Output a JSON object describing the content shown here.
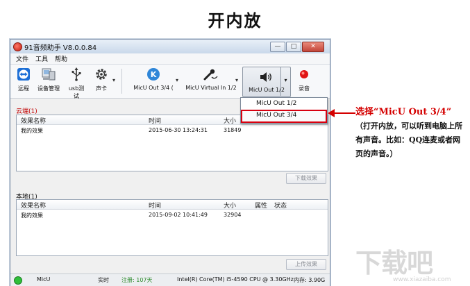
{
  "heading": "开内放",
  "window": {
    "title": "91音频助手 V8.0.0.84",
    "controls": {
      "minimize": "—",
      "maximize": "□",
      "close": "✕"
    },
    "menu": [
      "文件",
      "工具",
      "帮助"
    ]
  },
  "toolbar": {
    "remote": "远程",
    "devices": "设备管理",
    "usb": "usb测试",
    "soundcard": "声卡",
    "micu_out34": "MicU Out 3/4 (",
    "micu_virtual": "MicU Virtual In 1/2",
    "micu_out12": "MicU Out 1/2",
    "record": "录音"
  },
  "dropdown": {
    "options": [
      "MicU Out 1/2",
      "MicU Out 3/4"
    ],
    "selected_index": 1
  },
  "cloud": {
    "label": "云端(1)",
    "columns": [
      "效果名称",
      "时间",
      "大小"
    ],
    "rows": [
      {
        "name": "我的效果",
        "time": "2015-06-30 13:24:31",
        "size": "31849"
      }
    ],
    "button": "下载效果"
  },
  "local": {
    "label": "本地(1)",
    "columns": [
      "效果名称",
      "时间",
      "大小",
      "属性",
      "状态"
    ],
    "rows": [
      {
        "name": "我的效果",
        "time": "2015-09-02 10:41:49",
        "size": "32904"
      }
    ],
    "button": "上传效果"
  },
  "statusbar": {
    "device": "MicU",
    "mode": "实时",
    "registration": "注册: 107天",
    "cpu": "Intel(R) Core(TM) i5-4590 CPU @ 3.30GHz",
    "memory": "内存: 3.90G"
  },
  "annotation": {
    "title": "选择“MicU Out 3/4”",
    "body": "（打开内放，可以听到电脑上所有声音。比如：QQ连麦或者网页的声音。）"
  },
  "watermark": {
    "main": "下载吧",
    "sub": "www.xiazaiba.com"
  },
  "colors": {
    "accent_red": "#d40000",
    "registration_green": "#2a8a2a",
    "status_dot_green": "#2fbf3a",
    "title_bar": "#c9d8ea"
  },
  "icons": {
    "remote": "teamviewer-icon",
    "devices": "computer-icon",
    "usb": "usb-icon",
    "soundcard": "gear-icon",
    "micu_out34": "k-logo-icon",
    "micu_virtual": "microphone-icon",
    "micu_out12": "speaker-icon",
    "record": "record-dot-icon"
  }
}
